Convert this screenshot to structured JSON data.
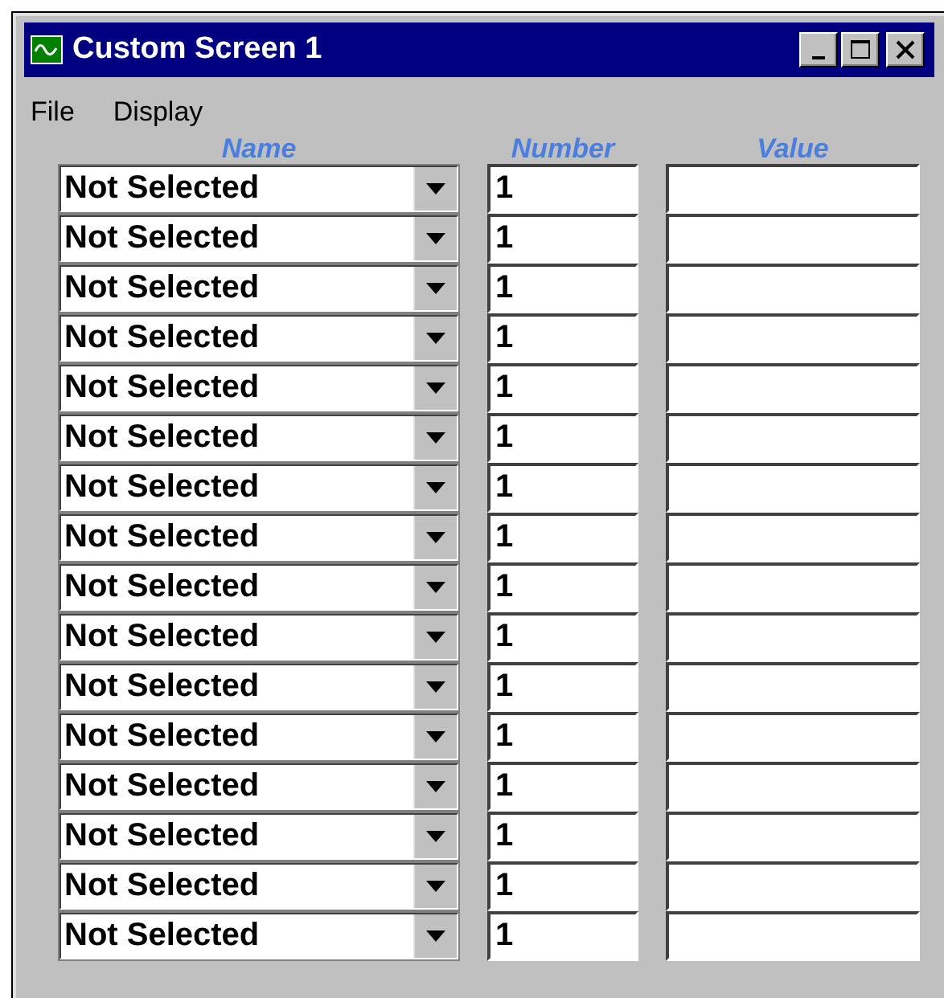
{
  "window": {
    "title": "Custom Screen 1"
  },
  "menu": [
    "File",
    "Display"
  ],
  "columns": [
    "Name",
    "Number",
    "Value"
  ],
  "rows": [
    {
      "name": "Not Selected",
      "number": "1"
    },
    {
      "name": "Not Selected",
      "number": "1"
    },
    {
      "name": "Not Selected",
      "number": "1"
    },
    {
      "name": "Not Selected",
      "number": "1"
    },
    {
      "name": "Not Selected",
      "number": "1"
    },
    {
      "name": "Not Selected",
      "number": "1"
    },
    {
      "name": "Not Selected",
      "number": "1"
    },
    {
      "name": "Not Selected",
      "number": "1"
    },
    {
      "name": "Not Selected",
      "number": "1"
    },
    {
      "name": "Not Selected",
      "number": "1"
    },
    {
      "name": "Not Selected",
      "number": "1"
    },
    {
      "name": "Not Selected",
      "number": "1"
    },
    {
      "name": "Not Selected",
      "number": "1"
    },
    {
      "name": "Not Selected",
      "number": "1"
    },
    {
      "name": "Not Selected",
      "number": "1"
    },
    {
      "name": "Not Selected",
      "number": "1"
    }
  ]
}
